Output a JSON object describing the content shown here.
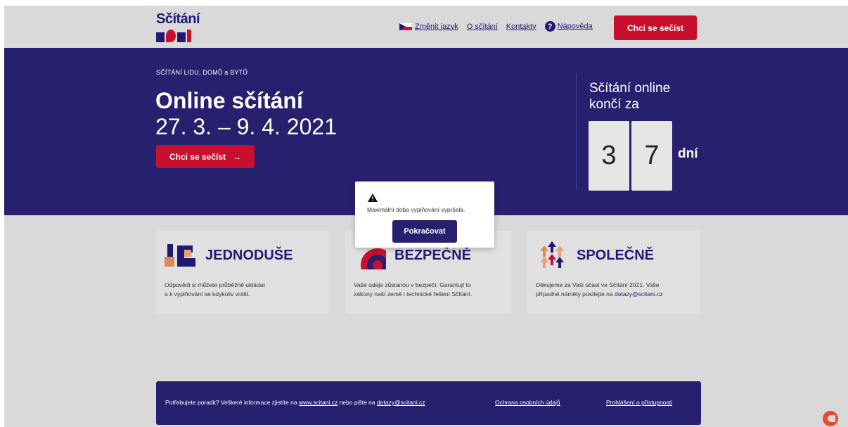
{
  "header": {
    "logo_text": "Sčítání",
    "logo_year": "2021",
    "nav": {
      "change_language": "Změnit jazyk",
      "about": "O sčítání",
      "contacts": "Kontakty",
      "help": "Nápověda"
    },
    "cta_label": "Chci se sečíst"
  },
  "hero": {
    "kicker": "SČÍTÁNÍ LIDU, DOMŮ a BYTŮ",
    "title_line1": "Online sčítání",
    "title_line2": "27. 3. – 9. 4. 2021",
    "cta_label": "Chci se sečíst",
    "cta_arrow": "→",
    "countdown_title_line1": "Sčítání online",
    "countdown_title_line2": "končí za",
    "digit1": "3",
    "digit2": "7",
    "days_label": "dní"
  },
  "cards": [
    {
      "title": "JEDNODUŠE",
      "text_line1": "Odpovědi si můžete průběžně ukládat",
      "text_line2": "a k vyplňování se kdykoliv vrátit."
    },
    {
      "title": "BEZPEČNĚ",
      "text_line1": "Vaše údaje zůstanou v bezpečí. Garantují to",
      "text_line2": "zákony naší země i technické řešení Sčítání."
    },
    {
      "title": "SPOLEČNĚ",
      "text_line1": "Děkujeme za Vaši účast ve Sčítání 2021. Vaše",
      "text_line2_prefix": "případné náměty posílejte na ",
      "text_line2_link": "dotazy@scitani.cz"
    }
  ],
  "footer": {
    "text_prefix": "Potřebujete poradit? Veškeré informace zjistíte na ",
    "web_link": "www.scitani.cz",
    "text_middle": " nebo pište na ",
    "email_link": "dotazy@scitani.cz",
    "privacy_link": "Ochrana osobních údajů",
    "accessibility_link": "Prohlášení o přístupnosti"
  },
  "modal": {
    "message": "Maximální doba vyplňování vypršela.",
    "button_label": "Pokračovat"
  },
  "colors": {
    "brand_navy": "#26206e",
    "brand_red": "#c8102e"
  }
}
